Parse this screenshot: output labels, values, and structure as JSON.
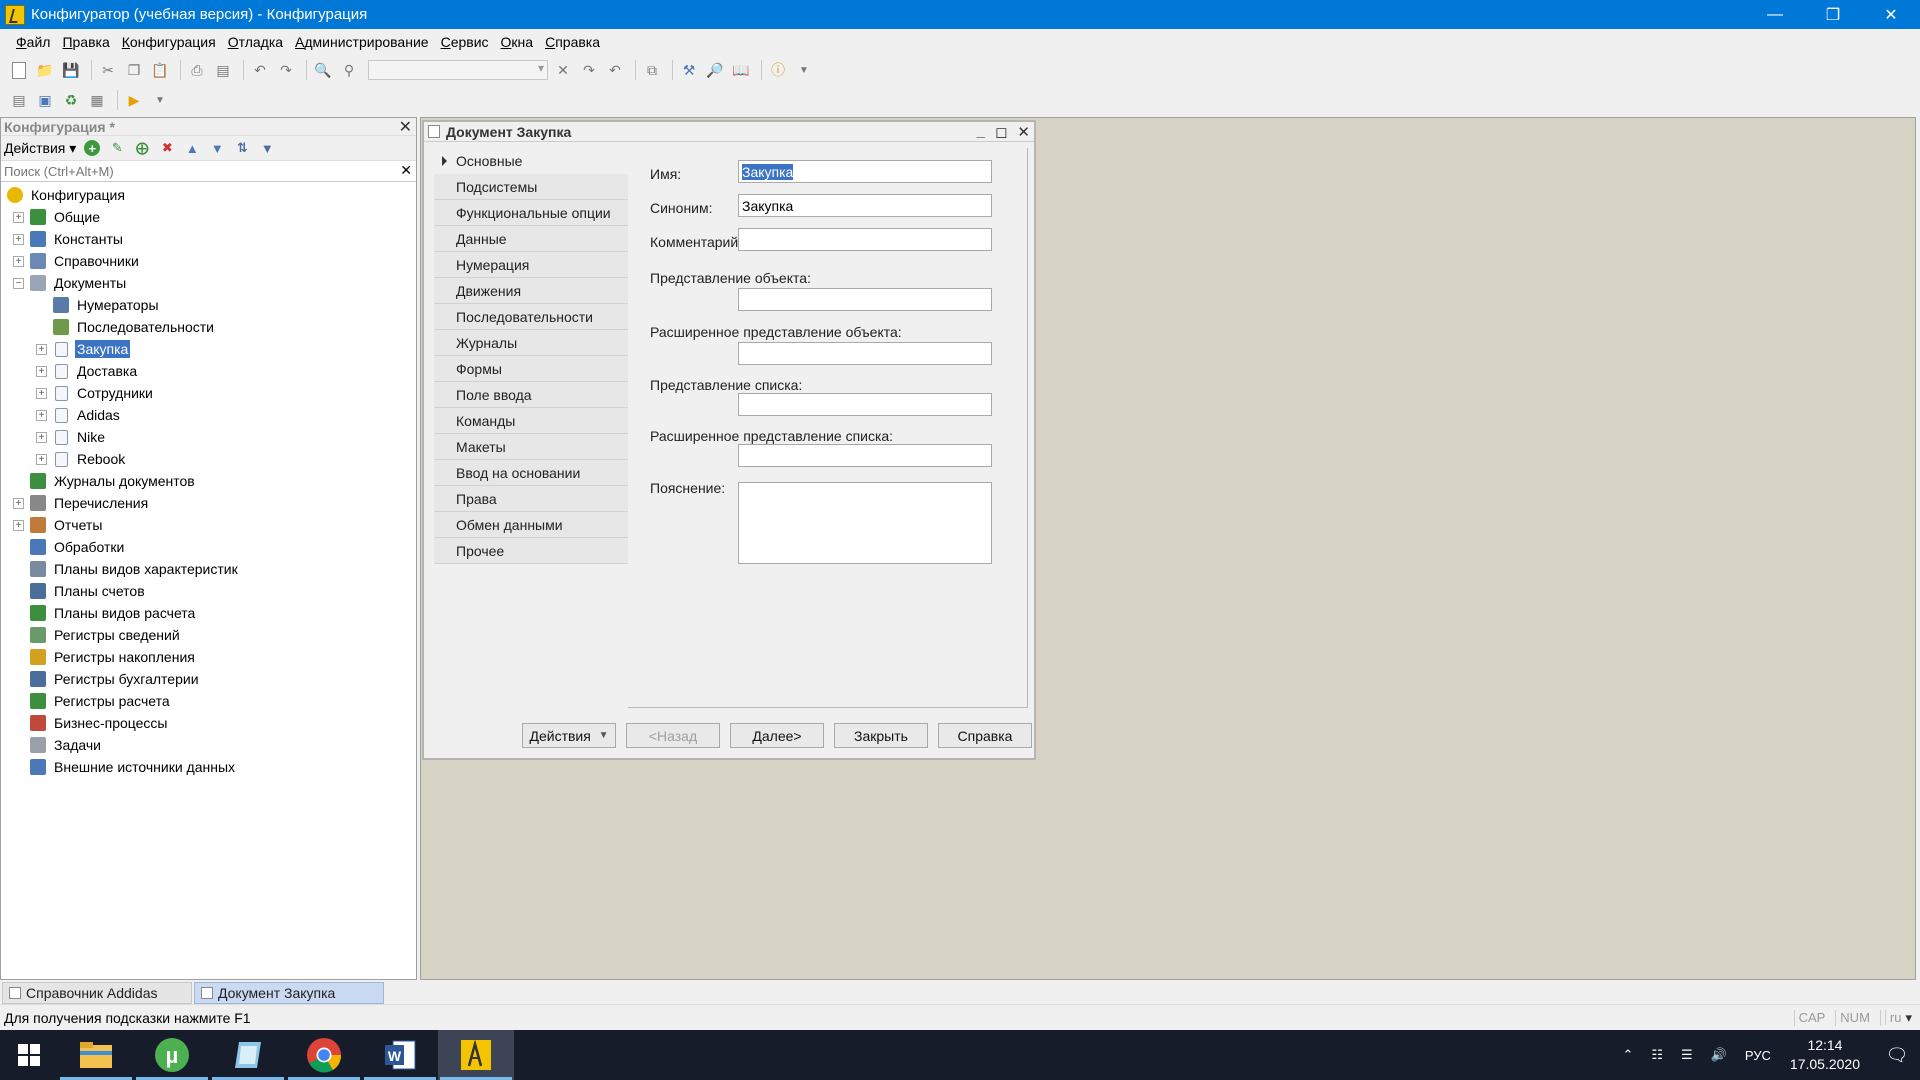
{
  "window": {
    "title": "Конфигуратор (учебная версия) - Конфигурация"
  },
  "menu": [
    "Файл",
    "Правка",
    "Конфигурация",
    "Отладка",
    "Администрирование",
    "Сервис",
    "Окна",
    "Справка"
  ],
  "left_panel": {
    "title": "Конфигурация *",
    "actions_label": "Действия",
    "search_placeholder": "Поиск (Ctrl+Alt+M)",
    "tree": [
      {
        "label": "Конфигурация",
        "level": 0,
        "expander": "none",
        "icon_color": "#e6b800",
        "icon": "config-icon"
      },
      {
        "label": "Общие",
        "level": 1,
        "expander": "plus",
        "icon_color": "#3c8f3c",
        "icon": "common-icon"
      },
      {
        "label": "Константы",
        "level": 1,
        "expander": "plus",
        "icon_color": "#4a78b8",
        "icon": "constants-icon"
      },
      {
        "label": "Справочники",
        "level": 1,
        "expander": "plus",
        "icon_color": "#6a8ab5",
        "icon": "catalog-icon"
      },
      {
        "label": "Документы",
        "level": 1,
        "expander": "minus",
        "icon_color": "#9aa6b8",
        "icon": "documents-icon"
      },
      {
        "label": "Нумераторы",
        "level": 2,
        "expander": "none",
        "icon_color": "#5a7aa8",
        "icon": "numerator-icon"
      },
      {
        "label": "Последовательности",
        "level": 2,
        "expander": "none",
        "icon_color": "#6e9a4a",
        "icon": "sequence-icon"
      },
      {
        "label": "Закупка",
        "level": 2,
        "expander": "plus",
        "icon_color": "#c4ccd8",
        "icon": "document-icon",
        "selected": true
      },
      {
        "label": "Доставка",
        "level": 2,
        "expander": "plus",
        "icon_color": "#c4ccd8",
        "icon": "document-icon"
      },
      {
        "label": "Сотрудники",
        "level": 2,
        "expander": "plus",
        "icon_color": "#c4ccd8",
        "icon": "document-icon"
      },
      {
        "label": "Adidas",
        "level": 2,
        "expander": "plus",
        "icon_color": "#c4ccd8",
        "icon": "document-icon"
      },
      {
        "label": "Nike",
        "level": 2,
        "expander": "plus",
        "icon_color": "#c4ccd8",
        "icon": "document-icon"
      },
      {
        "label": "Rebook",
        "level": 2,
        "expander": "plus",
        "icon_color": "#c4ccd8",
        "icon": "document-icon"
      },
      {
        "label": "Журналы документов",
        "level": 1,
        "expander": "none",
        "icon_color": "#3c8f3c",
        "icon": "journal-icon"
      },
      {
        "label": "Перечисления",
        "level": 1,
        "expander": "plus",
        "icon_color": "#888888",
        "icon": "enum-icon"
      },
      {
        "label": "Отчеты",
        "level": 1,
        "expander": "plus",
        "icon_color": "#c07a3a",
        "icon": "report-icon"
      },
      {
        "label": "Обработки",
        "level": 1,
        "expander": "none",
        "icon_color": "#4a78b8",
        "icon": "dataprocessor-icon"
      },
      {
        "label": "Планы видов характеристик",
        "level": 1,
        "expander": "none",
        "icon_color": "#7a8aa0",
        "icon": "chart-of-characteristics-icon"
      },
      {
        "label": "Планы счетов",
        "level": 1,
        "expander": "none",
        "icon_color": "#4a6e9a",
        "icon": "chart-of-accounts-icon"
      },
      {
        "label": "Планы видов расчета",
        "level": 1,
        "expander": "none",
        "icon_color": "#3c8f3c",
        "icon": "chart-of-calculation-icon"
      },
      {
        "label": "Регистры сведений",
        "level": 1,
        "expander": "none",
        "icon_color": "#6a9a6a",
        "icon": "info-register-icon"
      },
      {
        "label": "Регистры накопления",
        "level": 1,
        "expander": "none",
        "icon_color": "#d4a020",
        "icon": "accum-register-icon"
      },
      {
        "label": "Регистры бухгалтерии",
        "level": 1,
        "expander": "none",
        "icon_color": "#4a6e9a",
        "icon": "accounting-register-icon"
      },
      {
        "label": "Регистры расчета",
        "level": 1,
        "expander": "none",
        "icon_color": "#3c8f3c",
        "icon": "calculation-register-icon"
      },
      {
        "label": "Бизнес-процессы",
        "level": 1,
        "expander": "none",
        "icon_color": "#c04a3a",
        "icon": "business-process-icon"
      },
      {
        "label": "Задачи",
        "level": 1,
        "expander": "none",
        "icon_color": "#9aa0a8",
        "icon": "task-icon"
      },
      {
        "label": "Внешние источники данных",
        "level": 1,
        "expander": "none",
        "icon_color": "#4a78b8",
        "icon": "external-source-icon"
      }
    ]
  },
  "doc_window": {
    "title": "Документ Закупка",
    "nav": [
      "Основные",
      "Подсистемы",
      "Функциональные опции",
      "Данные",
      "Нумерация",
      "Движения",
      "Последовательности",
      "Журналы",
      "Формы",
      "Поле ввода",
      "Команды",
      "Макеты",
      "Ввод на основании",
      "Права",
      "Обмен данными",
      "Прочее"
    ],
    "active_nav": 0,
    "fields": {
      "name_label": "Имя:",
      "name_value": "Закупка",
      "synonym_label": "Синоним:",
      "synonym_value": "Закупка",
      "comment_label": "Комментарий:",
      "comment_value": "",
      "obj_repr_label": "Представление объекта:",
      "obj_repr_value": "",
      "ext_obj_repr_label": "Расширенное представление объекта:",
      "ext_obj_repr_value": "",
      "list_repr_label": "Представление списка:",
      "list_repr_value": "",
      "ext_list_repr_label": "Расширенное представление списка:",
      "ext_list_repr_value": "",
      "explanation_label": "Пояснение:",
      "explanation_value": ""
    },
    "buttons": {
      "actions": "Действия",
      "back": "<Назад",
      "next": "Далее>",
      "close": "Закрыть",
      "help": "Справка"
    }
  },
  "window_tabs": [
    "Справочник Addidas",
    "Документ Закупка"
  ],
  "status": {
    "hint": "Для получения подсказки нажмите F1",
    "cap": "CAP",
    "num": "NUM",
    "lang": "ru"
  },
  "taskbar": {
    "tray_lang": "РУС",
    "time": "12:14",
    "date": "17.05.2020"
  }
}
